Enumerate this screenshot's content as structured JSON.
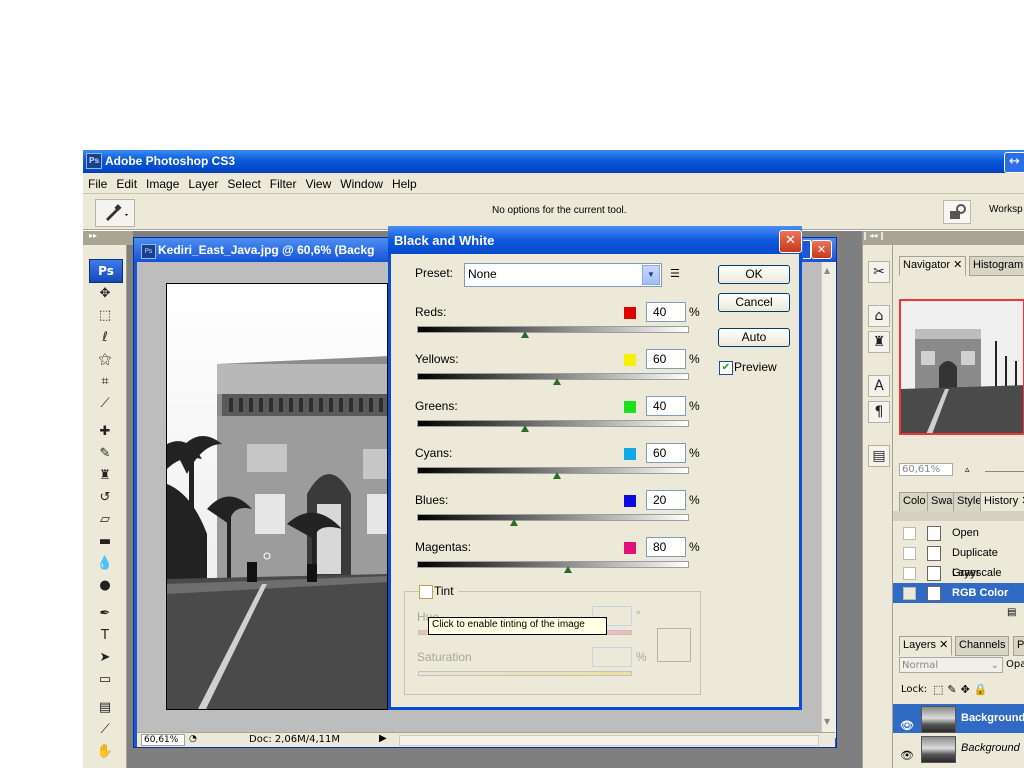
{
  "app": {
    "title": "Adobe Photoshop CS3",
    "logo": "Ps"
  },
  "menu": [
    "File",
    "Edit",
    "Image",
    "Layer",
    "Select",
    "Filter",
    "View",
    "Window",
    "Help"
  ],
  "options_bar": {
    "message": "No options for the current tool.",
    "workspace_label": "Worksp"
  },
  "toolbox_logo": "Ps",
  "document": {
    "title": "Kediri_East_Java.jpg @ 60,6% (Backg",
    "zoom": "60,61%",
    "doc_info": "Doc: 2,06M/4,11M"
  },
  "dialog": {
    "title": "Black and White",
    "preset_label": "Preset:",
    "preset_value": "None",
    "ok": "OK",
    "cancel": "Cancel",
    "auto": "Auto",
    "preview": "Preview",
    "channels": [
      {
        "name": "Reds:",
        "value": "40",
        "pct": "%",
        "color": "#e00000",
        "level": 0.4
      },
      {
        "name": "Yellows:",
        "value": "60",
        "pct": "%",
        "color": "#f7f000",
        "level": 0.52
      },
      {
        "name": "Greens:",
        "value": "40",
        "pct": "%",
        "color": "#19e21a",
        "level": 0.4
      },
      {
        "name": "Cyans:",
        "value": "60",
        "pct": "%",
        "color": "#10a8e8",
        "level": 0.52
      },
      {
        "name": "Blues:",
        "value": "20",
        "pct": "%",
        "color": "#0a0ae0",
        "level": 0.36
      },
      {
        "name": "Magentas:",
        "value": "80",
        "pct": "%",
        "color": "#e2107c",
        "level": 0.56
      }
    ],
    "tint": {
      "label": "Tint",
      "hue_label": "Hue",
      "hue_unit": "°",
      "saturation_label": "Saturation",
      "saturation_unit": "%",
      "tooltip": "Click to enable tinting of the image"
    }
  },
  "navigator": {
    "tabs": [
      "Navigator",
      "Histogram"
    ],
    "zoom": "60,61%"
  },
  "history": {
    "tabs": [
      "Colo",
      "Swa",
      "Style",
      "History"
    ],
    "items": [
      "Open",
      "Duplicate Layer",
      "Grayscale",
      "RGB Color"
    ]
  },
  "layers": {
    "tabs": [
      "Layers",
      "Channels",
      "P"
    ],
    "blend_mode": "Normal",
    "opacity_label": "Opa",
    "lock_label": "Lock:",
    "items": [
      "Background",
      "Background"
    ]
  }
}
